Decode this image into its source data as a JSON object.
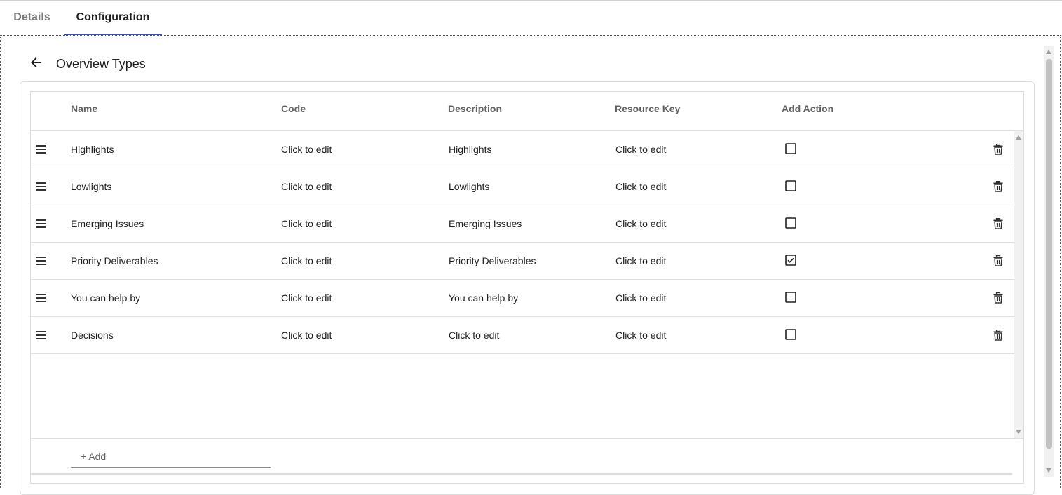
{
  "tabs": [
    {
      "label": "Details",
      "active": false
    },
    {
      "label": "Configuration",
      "active": true
    }
  ],
  "page": {
    "title": "Overview Types",
    "back_icon": "arrow-left-icon"
  },
  "table": {
    "columns": [
      "Name",
      "Code",
      "Description",
      "Resource Key",
      "Add Action"
    ],
    "rows": [
      {
        "name": "Highlights",
        "code": "Click to edit",
        "description": "Highlights",
        "resource_key": "Click to edit",
        "add_action": false
      },
      {
        "name": "Lowlights",
        "code": "Click to edit",
        "description": "Lowlights",
        "resource_key": "Click to edit",
        "add_action": false
      },
      {
        "name": "Emerging Issues",
        "code": "Click to edit",
        "description": "Emerging Issues",
        "resource_key": "Click to edit",
        "add_action": false
      },
      {
        "name": "Priority Deliverables",
        "code": "Click to edit",
        "description": "Priority Deliverables",
        "resource_key": "Click to edit",
        "add_action": true
      },
      {
        "name": "You can help by",
        "code": "Click to edit",
        "description": "You can help by",
        "resource_key": "Click to edit",
        "add_action": false
      },
      {
        "name": "Decisions",
        "code": "Click to edit",
        "description": "Click to edit",
        "resource_key": "Click to edit",
        "add_action": false
      }
    ],
    "add_label": "+ Add",
    "row_icons": {
      "drag": "drag-handle-icon",
      "delete": "trash-icon"
    }
  },
  "colors": {
    "accent": "#3f51b5",
    "border": "#dcdcdc",
    "header_text": "#616161"
  }
}
